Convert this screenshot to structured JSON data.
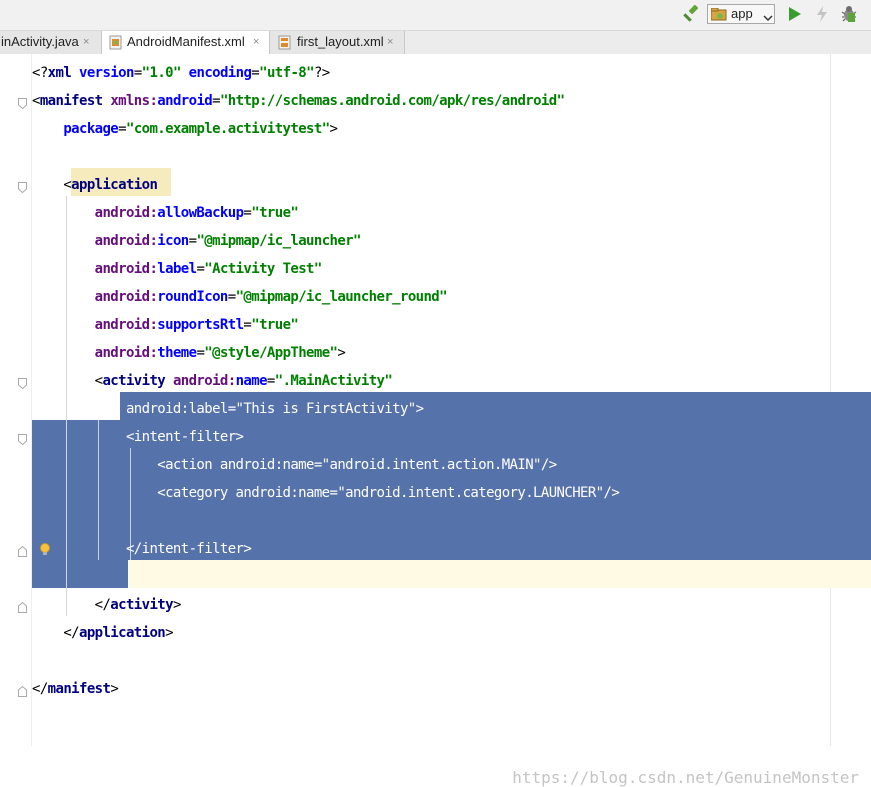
{
  "toolbar": {
    "run_config": "app",
    "icons": [
      "hammer-icon",
      "app-module-icon",
      "dropdown-chevron-icon",
      "run-icon",
      "apply-changes-icon",
      "debug-icon"
    ]
  },
  "tabs": [
    {
      "label": "inActivity.java",
      "close": "×",
      "active": false
    },
    {
      "label": "AndroidManifest.xml",
      "close": "×",
      "active": true
    },
    {
      "label": "first_layout.xml",
      "close": "×",
      "active": false
    }
  ],
  "editor": {
    "lines": [
      [
        [
          "pl",
          "<?"
        ],
        [
          "k",
          "xml "
        ],
        [
          "aa",
          "version"
        ],
        [
          "pl",
          "="
        ],
        [
          "v",
          "\"1.0\""
        ],
        [
          "pl",
          " "
        ],
        [
          "aa",
          "encoding"
        ],
        [
          "pl",
          "="
        ],
        [
          "v",
          "\"utf-8\""
        ],
        [
          "pl",
          "?>"
        ]
      ],
      [
        [
          "pl",
          "<"
        ],
        [
          "k",
          "manifest "
        ],
        [
          "an",
          "xmlns:"
        ],
        [
          "aa",
          "android"
        ],
        [
          "pl",
          "="
        ],
        [
          "v",
          "\"http://schemas.android.com/apk/res/android\""
        ]
      ],
      [
        [
          "pl",
          "    "
        ],
        [
          "aa",
          "package"
        ],
        [
          "pl",
          "="
        ],
        [
          "v",
          "\"com.example.activitytest\""
        ],
        [
          "pl",
          ">"
        ]
      ],
      [],
      [
        [
          "pl",
          "    <"
        ],
        [
          "k",
          "application"
        ]
      ],
      [
        [
          "pl",
          "        "
        ],
        [
          "an",
          "android:"
        ],
        [
          "aa",
          "allowBackup"
        ],
        [
          "pl",
          "="
        ],
        [
          "v",
          "\"true\""
        ]
      ],
      [
        [
          "pl",
          "        "
        ],
        [
          "an",
          "android:"
        ],
        [
          "aa",
          "icon"
        ],
        [
          "pl",
          "="
        ],
        [
          "v",
          "\"@mipmap/ic_launcher\""
        ]
      ],
      [
        [
          "pl",
          "        "
        ],
        [
          "an",
          "android:"
        ],
        [
          "aa",
          "label"
        ],
        [
          "pl",
          "="
        ],
        [
          "v",
          "\"Activity Test\""
        ]
      ],
      [
        [
          "pl",
          "        "
        ],
        [
          "an",
          "android:"
        ],
        [
          "aa",
          "roundIcon"
        ],
        [
          "pl",
          "="
        ],
        [
          "v",
          "\"@mipmap/ic_launcher_round\""
        ]
      ],
      [
        [
          "pl",
          "        "
        ],
        [
          "an",
          "android:"
        ],
        [
          "aa",
          "supportsRtl"
        ],
        [
          "pl",
          "="
        ],
        [
          "v",
          "\"true\""
        ]
      ],
      [
        [
          "pl",
          "        "
        ],
        [
          "an",
          "android:"
        ],
        [
          "aa",
          "theme"
        ],
        [
          "pl",
          "="
        ],
        [
          "v",
          "\"@style/AppTheme\""
        ],
        [
          "pl",
          ">"
        ]
      ],
      [
        [
          "pl",
          "        <"
        ],
        [
          "k",
          "activity "
        ],
        [
          "an",
          "android:"
        ],
        [
          "aa",
          "name"
        ],
        [
          "pl",
          "="
        ],
        [
          "v",
          "\".MainActivity\""
        ]
      ],
      [
        [
          "pl",
          "            "
        ],
        [
          "sel",
          "android:label=\"This is FirstActivity\">"
        ]
      ],
      [
        [
          "pl",
          "            "
        ],
        [
          "sel",
          "<intent-filter>"
        ]
      ],
      [
        [
          "pl",
          "                "
        ],
        [
          "sel",
          "<action android:name=\"android.intent.action.MAIN\"/>"
        ]
      ],
      [
        [
          "pl",
          "                "
        ],
        [
          "sel",
          "<category android:name=\"android.intent.category.LAUNCHER\"/>"
        ]
      ],
      [],
      [
        [
          "pl",
          "            "
        ],
        [
          "sel",
          "</intent-filter>"
        ]
      ],
      [],
      [
        [
          "pl",
          "        </"
        ],
        [
          "k",
          "activity"
        ],
        [
          "pl",
          ">"
        ]
      ],
      [
        [
          "pl",
          "    </"
        ],
        [
          "k",
          "application"
        ],
        [
          "pl",
          ">"
        ]
      ],
      [],
      [
        [
          "pl",
          "</"
        ],
        [
          "k",
          "manifest"
        ],
        [
          "pl",
          ">"
        ]
      ]
    ]
  },
  "watermark": "https://blog.csdn.net/GenuineMonster",
  "colors": {
    "selection": "#5672aa",
    "caret_line": "#fffae3",
    "tag_highlight": "#f6ebbc",
    "keyword": "#000080",
    "attribute_name": "#660e7a",
    "attribute": "#0000ff",
    "value": "#008000"
  }
}
